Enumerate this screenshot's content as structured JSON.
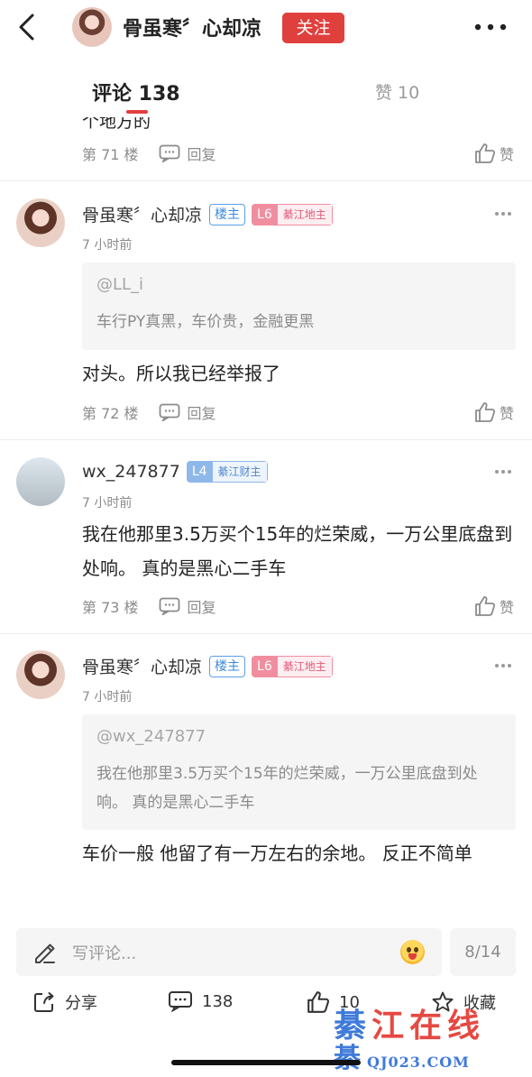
{
  "header": {
    "back_icon": "chevron-left-icon",
    "author_name": "骨虽寒〞心却凉",
    "follow_label": "关注",
    "more_icon": "more-horizontal-icon",
    "accent_color": "#e0403d"
  },
  "tabs": {
    "comments_label": "评论 138",
    "likes_label": "赞 10"
  },
  "feed": {
    "partial_text": "个地方的",
    "items": [
      {
        "floor": "第 71 楼",
        "reply_label": "回复",
        "like_label": "赞"
      },
      {
        "user": "骨虽寒〞心却凉",
        "owner_badge": "楼主",
        "level": "L6",
        "level_title": "綦江地主",
        "time": "7 小时前",
        "quote_user": "@LL_i",
        "quote_text": "车行PY真黑，车价贵，金融更黑",
        "text": "对头。所以我已经举报了",
        "floor": "第 72 楼",
        "reply_label": "回复",
        "like_label": "赞"
      },
      {
        "user": "wx_247877",
        "level": "L4",
        "level_title": "綦江财主",
        "time": "7 小时前",
        "text": "我在他那里3.5万买个15年的烂荣威，一万公里底盘到处响。 真的是黑心二手车",
        "floor": "第 73 楼",
        "reply_label": "回复",
        "like_label": "赞"
      },
      {
        "user": "骨虽寒〞心却凉",
        "owner_badge": "楼主",
        "level": "L6",
        "level_title": "綦江地主",
        "time": "7 小时前",
        "quote_user": "@wx_247877",
        "quote_text": "我在他那里3.5万买个15年的烂荣威，一万公里底盘到处响。 真的是黑心二手车",
        "text": "车价一般 他留了有一万左右的余地。 反正不简单"
      }
    ]
  },
  "bottom": {
    "comment_placeholder": "写评论...",
    "page_indicator": "8/14",
    "share_label": "分享",
    "comment_count": "138",
    "like_count": "10",
    "favorite_label": "收藏"
  },
  "watermark": {
    "top_text_1": "綦",
    "top_text_2": "江在线",
    "bottom_char": "綦",
    "bottom_domain": "QJ023.COM"
  }
}
